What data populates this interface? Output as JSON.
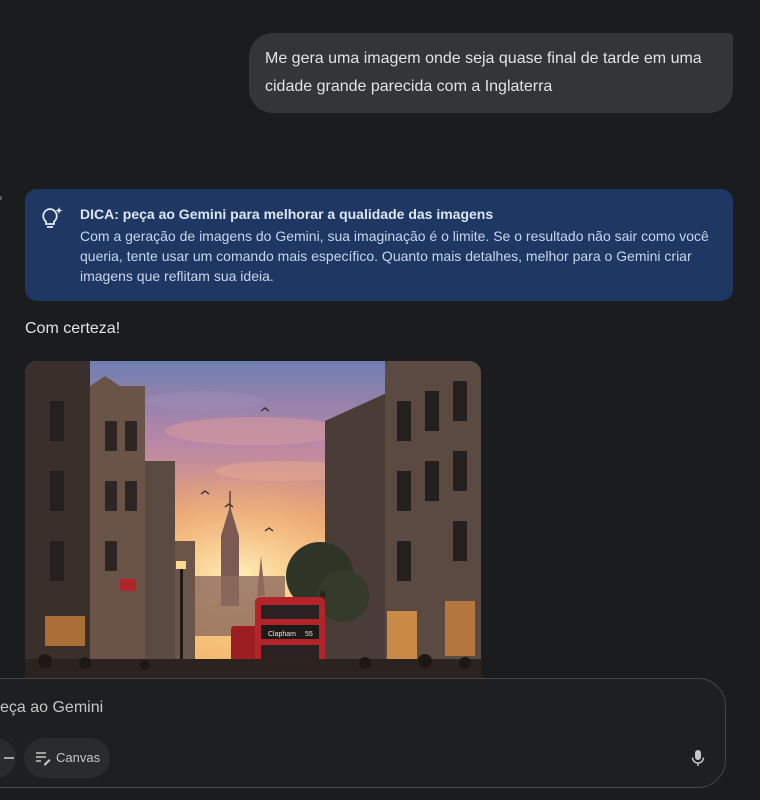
{
  "conversation": {
    "user_message": "Me gera uma imagem onde seja quase final de tarde em uma cidade grande parecida com a Inglaterra",
    "tip": {
      "title": "DICA: peça ao Gemini para melhorar a qualidade das imagens",
      "body": "Com a geração de imagens do Gemini, sua imaginação é o limite. Se o resultado não sair como você queria, tente usar um comando mais específico. Quanto mais detalhes, melhor para o Gemini criar imagens que reflitam sua ideia.",
      "icon": "lightbulb-sparkle-icon"
    },
    "reply_text": "Com certeza!",
    "image": {
      "bus_sign": "Clapham",
      "bus_number": "55"
    }
  },
  "composer": {
    "placeholder": "eça ao Gemini",
    "canvas_label": "Canvas",
    "icons": [
      "plus-icon",
      "canvas-icon",
      "mic-icon"
    ]
  },
  "colors": {
    "background": "#1b1c1d",
    "user_bubble": "#333537",
    "tip_card": "#1e3763",
    "bus_red": "#b3242a"
  }
}
